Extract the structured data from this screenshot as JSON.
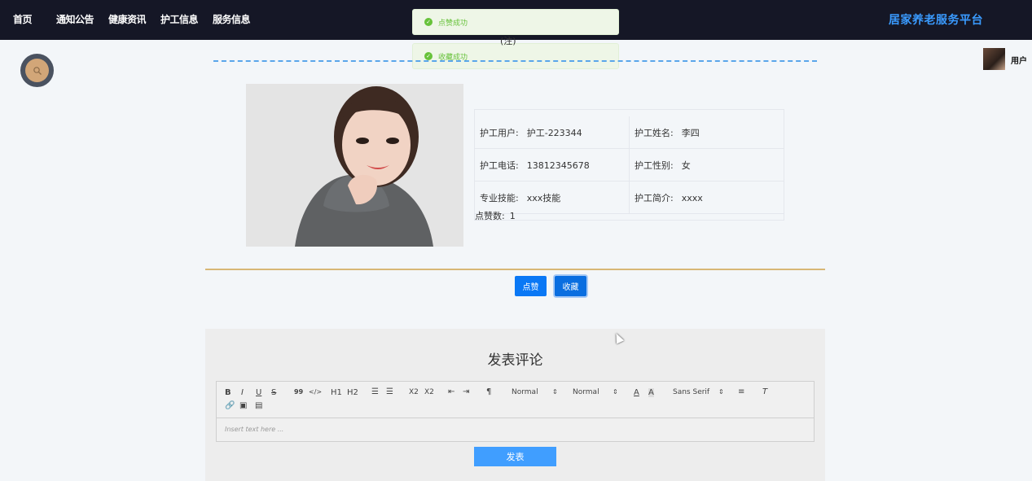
{
  "nav": {
    "items": [
      {
        "label": "首页"
      },
      {
        "label": "通知公告"
      },
      {
        "label": "健康资讯"
      },
      {
        "label": "护工信息"
      },
      {
        "label": "服务信息"
      }
    ],
    "brand": "居家养老服务平台"
  },
  "toasts": [
    {
      "text": "点赞成功",
      "icon": "check-circle-icon"
    },
    {
      "text": "收藏成功",
      "icon": "check-circle-icon"
    }
  ],
  "user": {
    "label": "用户"
  },
  "detail": {
    "title_fragment": "(注)",
    "fields": {
      "account_label": "护工用户:",
      "account_value": "护工-223344",
      "name_label": "护工姓名:",
      "name_value": "李四",
      "phone_label": "护工电话:",
      "phone_value": "13812345678",
      "gender_label": "护工性别:",
      "gender_value": "女",
      "skill_label": "专业技能:",
      "skill_value": "xxx技能",
      "intro_label": "护工简介:",
      "intro_value": "xxxx"
    },
    "likes_label": "点赞数:",
    "likes_value": "1"
  },
  "actions": {
    "like": "点赞",
    "favorite": "收藏"
  },
  "comment": {
    "title": "发表评论",
    "toolbar": {
      "bold": "B",
      "italic": "I",
      "underline": "U",
      "strike": "S",
      "quote": "99",
      "code": "</>",
      "h1": "H1",
      "h2": "H2",
      "sub": "X2",
      "sup": "X2",
      "size": "Normal",
      "header": "Normal",
      "font": "Sans Serif"
    },
    "placeholder": "Insert text here ...",
    "submit": "发表"
  },
  "colors": {
    "nav_bg": "#151726",
    "brand": "#3a9bff",
    "primary": "#0a78f5",
    "success": "#67c23a",
    "divider_gold": "#d8b776"
  }
}
